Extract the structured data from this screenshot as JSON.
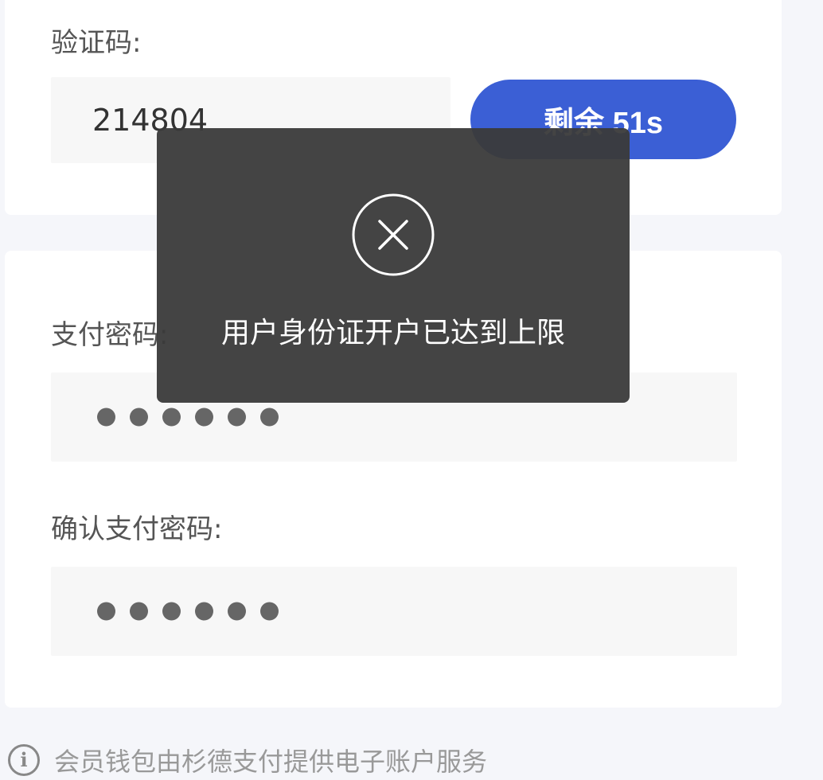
{
  "verify": {
    "label": "验证码:",
    "code_value": "214804",
    "countdown_label": "剩余 51s"
  },
  "password": {
    "label": "支付密码:",
    "masked_length": 6,
    "confirm_label": "确认支付密码:",
    "confirm_masked_length": 6
  },
  "toast": {
    "icon": "close-circle-icon",
    "message": "用户身份证开户已达到上限"
  },
  "footer": {
    "icon": "info-icon",
    "icon_glyph": "i",
    "text": "会员钱包由杉德支付提供电子账户服务"
  },
  "colors": {
    "accent": "#3b5fd5",
    "toast_bg": "#3a3a3a",
    "page_bg": "#f5f6fa"
  }
}
